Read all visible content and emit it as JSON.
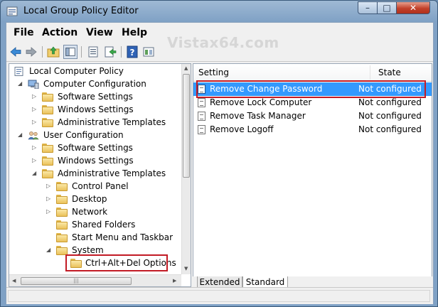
{
  "window": {
    "title": "Local Group Policy Editor",
    "minimize_glyph": "–",
    "maximize_glyph": "□",
    "close_glyph": "✕"
  },
  "watermark": "Vistax64.com",
  "menu": {
    "file": "File",
    "action": "Action",
    "view": "View",
    "help": "Help"
  },
  "tree": {
    "root": "Local Computer Policy",
    "computer_config": "Computer Configuration",
    "cc_software": "Software Settings",
    "cc_windows": "Windows Settings",
    "cc_admin": "Administrative Templates",
    "user_config": "User Configuration",
    "uc_software": "Software Settings",
    "uc_windows": "Windows Settings",
    "uc_admin": "Administrative Templates",
    "control_panel": "Control Panel",
    "desktop": "Desktop",
    "network": "Network",
    "shared_folders": "Shared Folders",
    "start_menu": "Start Menu and Taskbar",
    "system": "System",
    "ctrl_alt_del": "Ctrl+Alt+Del Options"
  },
  "list": {
    "col_setting": "Setting",
    "col_state": "State",
    "rows": [
      {
        "setting": "Remove Change Password",
        "state": "Not configured"
      },
      {
        "setting": "Remove Lock Computer",
        "state": "Not configured"
      },
      {
        "setting": "Remove Task Manager",
        "state": "Not configured"
      },
      {
        "setting": "Remove Logoff",
        "state": "Not configured"
      }
    ]
  },
  "tabs": {
    "extended": "Extended",
    "standard": "Standard"
  },
  "colors": {
    "selection": "#3399ff",
    "highlight_box": "#c21b25"
  }
}
